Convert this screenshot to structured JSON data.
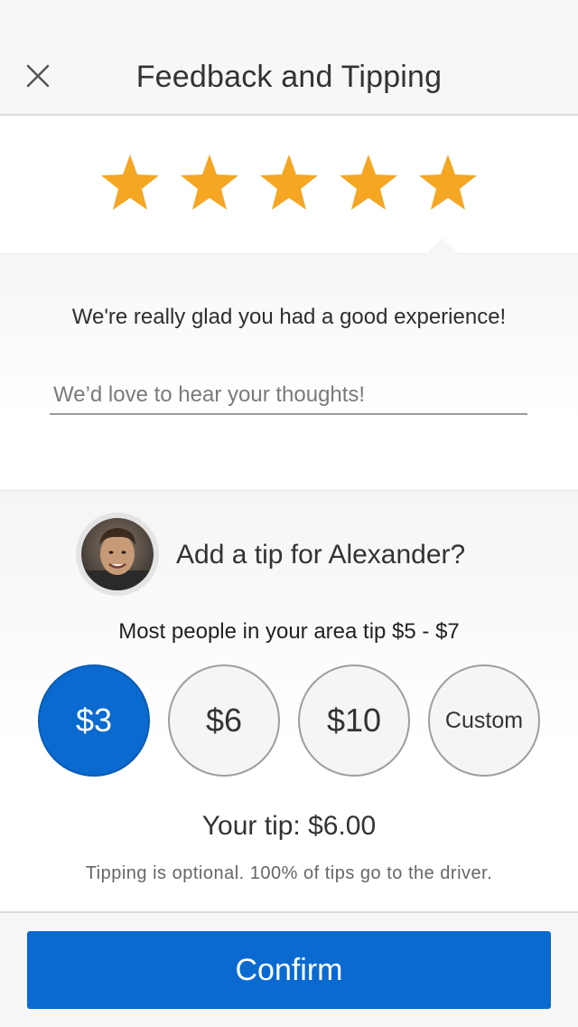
{
  "header": {
    "title": "Feedback and Tipping",
    "close_icon": "close-icon"
  },
  "rating": {
    "value": 5,
    "max": 5,
    "star_color": "#F5A623"
  },
  "feedback": {
    "message": "We're really glad you had a good experience!",
    "placeholder": "We’d love to hear your thoughts!",
    "value": ""
  },
  "tip": {
    "question": "Add a tip for Alexander?",
    "hint": "Most people in your area tip $5 - $7",
    "options": [
      "$3",
      "$6",
      "$10",
      "Custom"
    ],
    "selected_option": "$3",
    "your_tip": "Your tip: $6.00",
    "note": "Tipping is optional. 100% of tips go to the driver."
  },
  "footer": {
    "confirm_label": "Confirm"
  },
  "colors": {
    "accent": "#0A6AD0",
    "star": "#F5A623"
  }
}
